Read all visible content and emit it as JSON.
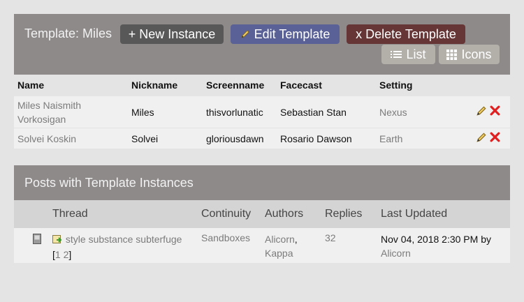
{
  "template": {
    "title": "Template: Miles",
    "new_instance_label": "+ New Instance",
    "edit_label": "Edit Template",
    "delete_label": "x Delete Template",
    "list_label": "List",
    "icons_label": "Icons"
  },
  "table": {
    "headers": [
      "Name",
      "Nickname",
      "Screenname",
      "Facecast",
      "Setting"
    ],
    "rows": [
      {
        "name_line1": "Miles Naismith",
        "name_line2": "Vorkosigan",
        "nickname": "Miles",
        "screenname": "thisvorlunatic",
        "facecast": "Sebastian Stan",
        "setting": "Nexus"
      },
      {
        "name_line1": "Solvei Koskin",
        "name_line2": "",
        "nickname": "Solvei",
        "screenname": "gloriousdawn",
        "facecast": "Rosario Dawson",
        "setting": "Earth"
      }
    ]
  },
  "posts": {
    "title": "Posts with Template Instances",
    "headers": {
      "thread": "Thread",
      "continuity": "Continuity",
      "authors": "Authors",
      "replies": "Replies",
      "updated": "Last Updated"
    },
    "rows": [
      {
        "thread": "style substance subterfuge",
        "page_open": "[",
        "page1": "1",
        "page2": "2",
        "page_close": "]",
        "continuity": "Sandboxes",
        "author1": "Alicorn",
        "author_sep": ",",
        "author2": "Kappa",
        "replies": "32",
        "updated": "Nov 04, 2018 2:30 PM by",
        "updated_by": "Alicorn"
      }
    ]
  },
  "colors": {
    "header_bg": "#8e8a8a",
    "edit_button": "#5a6196",
    "delete_button": "#663535",
    "new_button": "#585858",
    "toggle_button": "#b3b0aa",
    "delete_icon": "#e02020"
  },
  "icons": [
    "pencil-icon",
    "list-icon",
    "grid-icon",
    "delete-x-icon",
    "thread-status-icon",
    "new-post-icon"
  ]
}
